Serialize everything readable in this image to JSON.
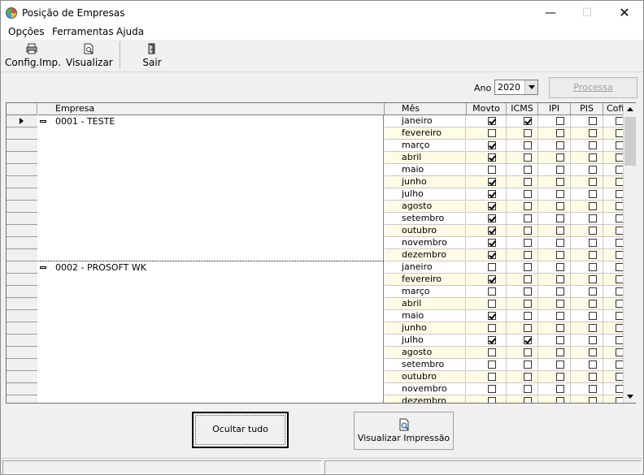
{
  "window": {
    "title": "Posição de Empresas",
    "min_glyph": "—",
    "max_glyph": "☐",
    "close_glyph": "✕"
  },
  "menu": [
    {
      "label": "Opções"
    },
    {
      "label": "Ferramentas"
    },
    {
      "label": "Ajuda"
    }
  ],
  "toolbar": {
    "config_label": "Config.Imp.",
    "config_icon": "printer-config-icon",
    "visualizar_label": "Visualizar",
    "visualizar_icon": "document-preview-icon",
    "sair_label": "Sair",
    "sair_icon": "exit-door-icon"
  },
  "filter": {
    "ano_label": "Ano",
    "ano_value": "2020",
    "processa_label": "Processa"
  },
  "grid": {
    "columns": {
      "empresa": "Empresa",
      "mes": "Mês",
      "flags": [
        "Movto",
        "ICMS",
        "IPI",
        "PIS",
        "Cofi"
      ]
    },
    "groups": [
      {
        "empresa": "0001 - TESTE",
        "rows": [
          {
            "mes": "janeiro",
            "flags": [
              true,
              true,
              false,
              false,
              false
            ]
          },
          {
            "mes": "fevereiro",
            "flags": [
              false,
              false,
              false,
              false,
              false
            ]
          },
          {
            "mes": "março",
            "flags": [
              true,
              false,
              false,
              false,
              false
            ]
          },
          {
            "mes": "abril",
            "flags": [
              true,
              false,
              false,
              false,
              false
            ]
          },
          {
            "mes": "maio",
            "flags": [
              false,
              false,
              false,
              false,
              false
            ]
          },
          {
            "mes": "junho",
            "flags": [
              true,
              false,
              false,
              false,
              false
            ]
          },
          {
            "mes": "julho",
            "flags": [
              true,
              false,
              false,
              false,
              false
            ]
          },
          {
            "mes": "agosto",
            "flags": [
              true,
              false,
              false,
              false,
              false
            ]
          },
          {
            "mes": "setembro",
            "flags": [
              true,
              false,
              false,
              false,
              false
            ]
          },
          {
            "mes": "outubro",
            "flags": [
              true,
              false,
              false,
              false,
              false
            ]
          },
          {
            "mes": "novembro",
            "flags": [
              true,
              false,
              false,
              false,
              false
            ]
          },
          {
            "mes": "dezembro",
            "flags": [
              true,
              false,
              false,
              false,
              false
            ]
          }
        ]
      },
      {
        "empresa": "0002 - PROSOFT WK",
        "rows": [
          {
            "mes": "janeiro",
            "flags": [
              false,
              false,
              false,
              false,
              false
            ]
          },
          {
            "mes": "fevereiro",
            "flags": [
              true,
              false,
              false,
              false,
              false
            ]
          },
          {
            "mes": "março",
            "flags": [
              false,
              false,
              false,
              false,
              false
            ]
          },
          {
            "mes": "abril",
            "flags": [
              false,
              false,
              false,
              false,
              false
            ]
          },
          {
            "mes": "maio",
            "flags": [
              true,
              false,
              false,
              false,
              false
            ]
          },
          {
            "mes": "junho",
            "flags": [
              false,
              false,
              false,
              false,
              false
            ]
          },
          {
            "mes": "julho",
            "flags": [
              true,
              true,
              false,
              false,
              false
            ]
          },
          {
            "mes": "agosto",
            "flags": [
              false,
              false,
              false,
              false,
              false
            ]
          },
          {
            "mes": "setembro",
            "flags": [
              false,
              false,
              false,
              false,
              false
            ]
          },
          {
            "mes": "outubro",
            "flags": [
              false,
              false,
              false,
              false,
              false
            ]
          },
          {
            "mes": "novembro",
            "flags": [
              false,
              false,
              false,
              false,
              false
            ]
          },
          {
            "mes": "dezembro",
            "flags": [
              false,
              false,
              false,
              false,
              false
            ]
          }
        ]
      }
    ]
  },
  "buttons": {
    "ocultar_tudo": "Ocultar tudo",
    "visualizar_impressao": "Visualizar Impressão",
    "visualizar_impressao_icon": "print-preview-icon"
  },
  "colors": {
    "alt_row": "#fffbe4",
    "accent": "#f0f0f0"
  }
}
